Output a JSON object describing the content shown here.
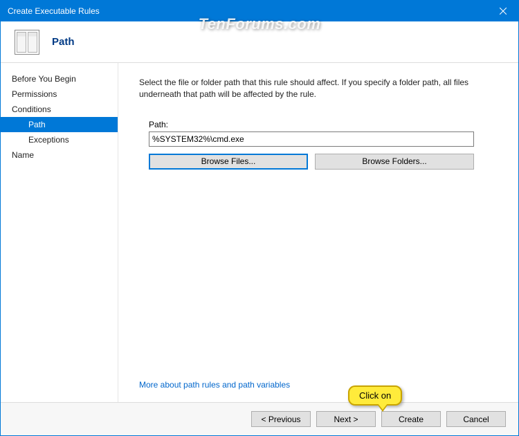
{
  "window": {
    "title": "Create Executable Rules"
  },
  "header": {
    "title": "Path"
  },
  "sidebar": {
    "items": [
      {
        "label": "Before You Begin"
      },
      {
        "label": "Permissions"
      },
      {
        "label": "Conditions"
      },
      {
        "label": "Path"
      },
      {
        "label": "Exceptions"
      },
      {
        "label": "Name"
      }
    ]
  },
  "content": {
    "description": "Select the file or folder path that this rule should affect. If you specify a folder path, all files underneath that path will be affected by the rule.",
    "path_label": "Path:",
    "path_value": "%SYSTEM32%\\cmd.exe",
    "browse_files": "Browse Files...",
    "browse_folders": "Browse Folders...",
    "more_link": "More about path rules and path variables"
  },
  "footer": {
    "previous": "< Previous",
    "next": "Next >",
    "create": "Create",
    "cancel": "Cancel"
  },
  "annotation": {
    "callout": "Click on"
  },
  "watermark": "TenForums.com"
}
